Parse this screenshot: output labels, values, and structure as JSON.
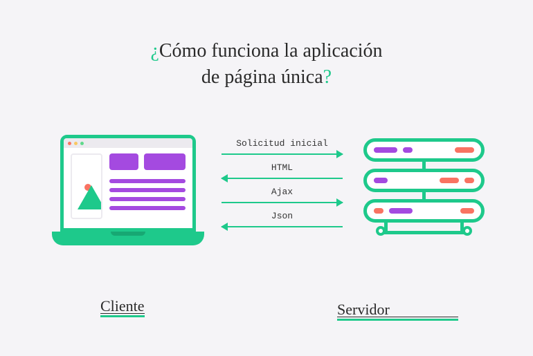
{
  "title": {
    "open_q": "¿",
    "line1": "Cómo funciona la aplicación",
    "line2": "de página única",
    "close_q": "?"
  },
  "arrows": [
    {
      "label": "Solicitud inicial",
      "direction": "right"
    },
    {
      "label": "HTML",
      "direction": "left"
    },
    {
      "label": "Ajax",
      "direction": "right"
    },
    {
      "label": "Json",
      "direction": "left"
    }
  ],
  "labels": {
    "client": "Cliente",
    "server": "Servidor"
  },
  "colors": {
    "accent": "#1ec98b",
    "purple": "#a44ae0",
    "orange": "#f97362"
  }
}
